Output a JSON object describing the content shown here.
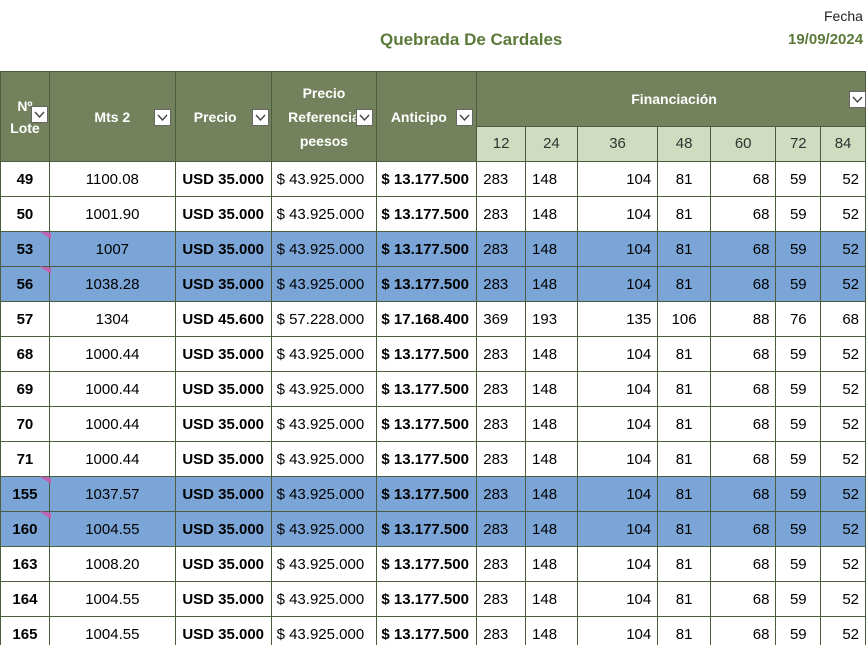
{
  "title": "Quebrada De Cardales",
  "fecha": {
    "label": "Fecha",
    "value": "19/09/2024"
  },
  "headers": {
    "lote": "Nº Lote",
    "mts": "Mts 2",
    "precio": "Precio",
    "precio_ref": "Precio Referencia peesos",
    "anticipo": "Anticipo",
    "financiacion": "Financiación",
    "months": [
      "12",
      "24",
      "36",
      "48",
      "60",
      "72",
      "84"
    ]
  },
  "rows": [
    {
      "lote": "49",
      "mts": "1100.08",
      "precio": "USD 35.000",
      "ref": "$ 43.925.000",
      "anticipo": "$ 13.177.500",
      "cuotas": [
        "283",
        "148",
        "104",
        "81",
        "68",
        "59",
        "52"
      ],
      "highlight": false
    },
    {
      "lote": "50",
      "mts": "1001.90",
      "precio": "USD 35.000",
      "ref": "$ 43.925.000",
      "anticipo": "$ 13.177.500",
      "cuotas": [
        "283",
        "148",
        "104",
        "81",
        "68",
        "59",
        "52"
      ],
      "highlight": false
    },
    {
      "lote": "53",
      "mts": "1007",
      "precio": "USD 35.000",
      "ref": "$ 43.925.000",
      "anticipo": "$ 13.177.500",
      "cuotas": [
        "283",
        "148",
        "104",
        "81",
        "68",
        "59",
        "52"
      ],
      "highlight": true
    },
    {
      "lote": "56",
      "mts": "1038.28",
      "precio": "USD 35.000",
      "ref": "$ 43.925.000",
      "anticipo": "$ 13.177.500",
      "cuotas": [
        "283",
        "148",
        "104",
        "81",
        "68",
        "59",
        "52"
      ],
      "highlight": true
    },
    {
      "lote": "57",
      "mts": "1304",
      "precio": "USD 45.600",
      "ref": "$ 57.228.000",
      "anticipo": "$ 17.168.400",
      "cuotas": [
        "369",
        "193",
        "135",
        "106",
        "88",
        "76",
        "68"
      ],
      "highlight": false
    },
    {
      "lote": "68",
      "mts": "1000.44",
      "precio": "USD 35.000",
      "ref": "$ 43.925.000",
      "anticipo": "$ 13.177.500",
      "cuotas": [
        "283",
        "148",
        "104",
        "81",
        "68",
        "59",
        "52"
      ],
      "highlight": false
    },
    {
      "lote": "69",
      "mts": "1000.44",
      "precio": "USD 35.000",
      "ref": "$ 43.925.000",
      "anticipo": "$ 13.177.500",
      "cuotas": [
        "283",
        "148",
        "104",
        "81",
        "68",
        "59",
        "52"
      ],
      "highlight": false
    },
    {
      "lote": "70",
      "mts": "1000.44",
      "precio": "USD 35.000",
      "ref": "$ 43.925.000",
      "anticipo": "$ 13.177.500",
      "cuotas": [
        "283",
        "148",
        "104",
        "81",
        "68",
        "59",
        "52"
      ],
      "highlight": false
    },
    {
      "lote": "71",
      "mts": "1000.44",
      "precio": "USD 35.000",
      "ref": "$ 43.925.000",
      "anticipo": "$ 13.177.500",
      "cuotas": [
        "283",
        "148",
        "104",
        "81",
        "68",
        "59",
        "52"
      ],
      "highlight": false
    },
    {
      "lote": "155",
      "mts": "1037.57",
      "precio": "USD 35.000",
      "ref": "$ 43.925.000",
      "anticipo": "$ 13.177.500",
      "cuotas": [
        "283",
        "148",
        "104",
        "81",
        "68",
        "59",
        "52"
      ],
      "highlight": true
    },
    {
      "lote": "160",
      "mts": "1004.55",
      "precio": "USD 35.000",
      "ref": "$ 43.925.000",
      "anticipo": "$ 13.177.500",
      "cuotas": [
        "283",
        "148",
        "104",
        "81",
        "68",
        "59",
        "52"
      ],
      "highlight": true
    },
    {
      "lote": "163",
      "mts": "1008.20",
      "precio": "USD 35.000",
      "ref": "$ 43.925.000",
      "anticipo": "$ 13.177.500",
      "cuotas": [
        "283",
        "148",
        "104",
        "81",
        "68",
        "59",
        "52"
      ],
      "highlight": false
    },
    {
      "lote": "164",
      "mts": "1004.55",
      "precio": "USD 35.000",
      "ref": "$ 43.925.000",
      "anticipo": "$ 13.177.500",
      "cuotas": [
        "283",
        "148",
        "104",
        "81",
        "68",
        "59",
        "52"
      ],
      "highlight": false
    },
    {
      "lote": "165",
      "mts": "1004.55",
      "precio": "USD 35.000",
      "ref": "$ 43.925.000",
      "anticipo": "$ 13.177.500",
      "cuotas": [
        "283",
        "148",
        "104",
        "81",
        "68",
        "59",
        "52"
      ],
      "highlight": false
    }
  ],
  "colors": {
    "header_bg": "#73825c",
    "subheader_bg": "#cfdcbf",
    "highlight_row": "#7aa5d6",
    "title_green": "#5b7a3a",
    "comment_marker": "#c45fb0"
  },
  "icons": {
    "filter": "filter-dropdown-icon"
  }
}
